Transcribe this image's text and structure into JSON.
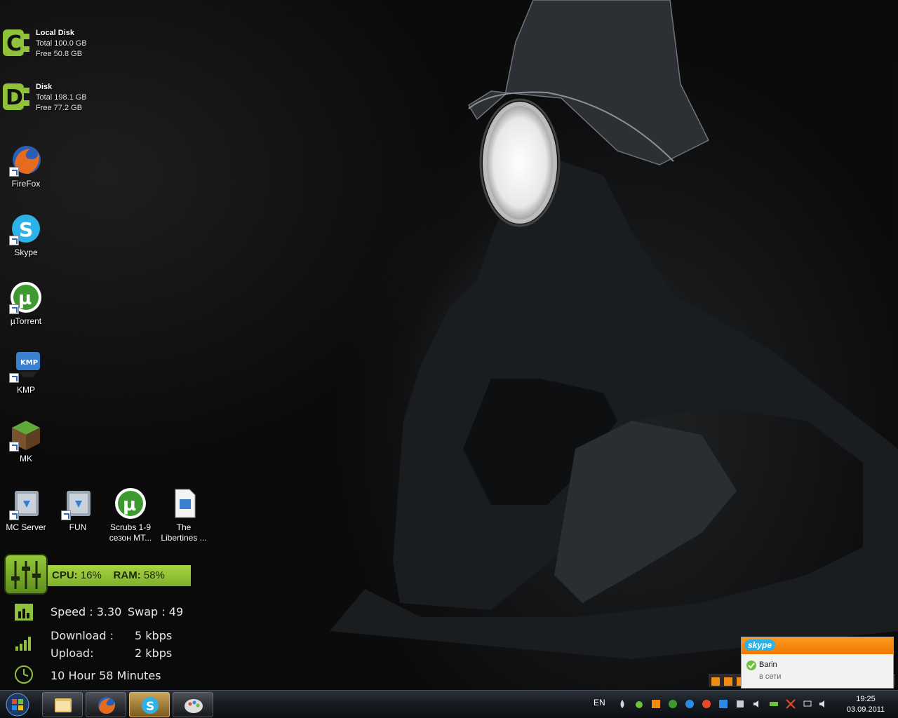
{
  "disks": [
    {
      "letter": "C",
      "name": "Local Disk",
      "total": "Total 100.0 GB",
      "free": "Free 50.8 GB"
    },
    {
      "letter": "D",
      "name": "Disk",
      "total": "Total 198.1 GB",
      "free": "Free 77.2 GB"
    }
  ],
  "desktop_icons": [
    {
      "label": "FireFox",
      "icon": "firefox-icon"
    },
    {
      "label": "Skype",
      "icon": "skype-icon"
    },
    {
      "label": "µTorrent",
      "icon": "utorrent-icon"
    },
    {
      "label": "KMP",
      "icon": "kmplayer-icon"
    },
    {
      "label": "MK",
      "icon": "minecraft-icon"
    },
    {
      "label": "MC Server",
      "icon": "folder-icon"
    },
    {
      "label": "FUN",
      "icon": "folder-icon"
    },
    {
      "label": "Scrubs 1-9",
      "label2": "сезон MT...",
      "icon": "utorrent-file-icon"
    },
    {
      "label": "The",
      "label2": "Libertines ...",
      "icon": "media-file-icon"
    }
  ],
  "sysmon": {
    "cpu_label": "CPU:",
    "cpu_value": "16%",
    "ram_label": "RAM:",
    "ram_value": "58%",
    "speed": "Speed : 3.30",
    "swap": "Swap :  49",
    "download_label": "Download :",
    "download_value": "5 kbps",
    "upload_label": "Upload:",
    "upload_value": "2 kbps",
    "uptime": "10 Hour 58  Minutes"
  },
  "skype_popup": {
    "logo": "skype",
    "contact": "Barin",
    "status": "в сети"
  },
  "taskbar": {
    "buttons": [
      "explorer-icon",
      "firefox-icon",
      "skype-icon",
      "paint-icon"
    ],
    "language": "EN",
    "time": "19:25",
    "date": "03.09.2011"
  },
  "colors": {
    "accent_green": "#8fc13a",
    "skype_orange": "#f58a10",
    "skype_blue": "#2db2e8"
  }
}
